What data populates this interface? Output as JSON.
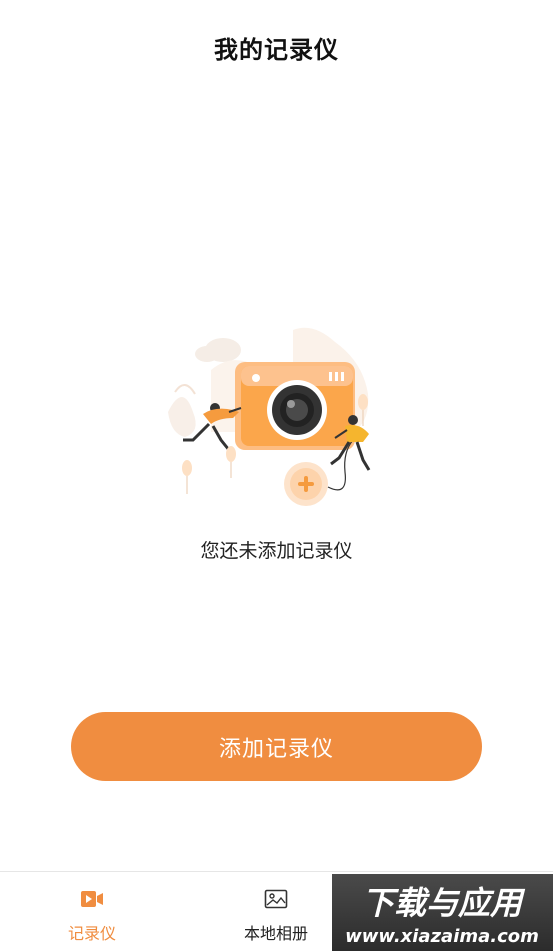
{
  "header": {
    "title": "我的记录仪"
  },
  "empty_state": {
    "illustration": "camera-with-people-icon",
    "message": "您还未添加记录仪"
  },
  "actions": {
    "add_label": "添加记录仪"
  },
  "tabbar": {
    "items": [
      {
        "label": "记录仪",
        "icon": "recorder-icon",
        "active": true
      },
      {
        "label": "本地相册",
        "icon": "photo-album-icon",
        "active": false
      }
    ]
  },
  "watermark": {
    "title": "下载与应用",
    "url": "www.xiazaima.com"
  },
  "colors": {
    "accent": "#f08d40",
    "camera": "#fba64b",
    "title": "#111111"
  }
}
